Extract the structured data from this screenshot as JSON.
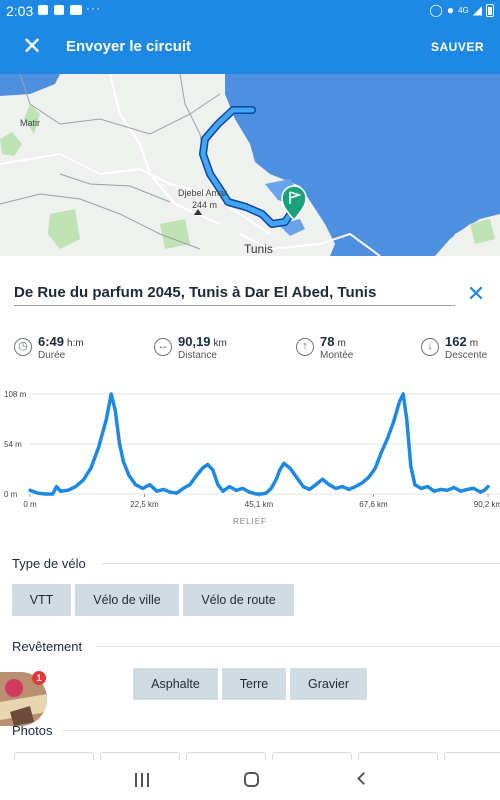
{
  "status_bar": {
    "time": "2:03",
    "dots": "···",
    "network": "4G"
  },
  "app_bar": {
    "title": "Envoyer le circuit",
    "save_label": "SAUVER"
  },
  "map": {
    "labels": {
      "matir": "Matir",
      "djebel": "Djebel Amar",
      "altitude": "244 m",
      "tunis": "Tunis"
    },
    "colors": {
      "sea": "#4f8fe0",
      "land": "#eef1ee",
      "route": "#1e88e5",
      "route_casing": "#0d47a1",
      "marker": "#1aa37a"
    }
  },
  "route": {
    "name": "De Rue du parfum 2045, Tunis à Dar El Abed, Tunis"
  },
  "stats": [
    {
      "icon": "clock-icon",
      "value": "6:49",
      "unit": "h:m",
      "label": "Durée"
    },
    {
      "icon": "distance-icon",
      "value": "90,19",
      "unit": "km",
      "label": "Distance"
    },
    {
      "icon": "arrow-up-icon",
      "value": "78",
      "unit": "m",
      "label": "Montée"
    },
    {
      "icon": "arrow-down-icon",
      "value": "162",
      "unit": "m",
      "label": "Descente"
    }
  ],
  "chart_data": {
    "type": "line",
    "title": "",
    "caption": "RELIEF",
    "xlabel": "",
    "ylabel": "",
    "x_ticks": [
      "0 m",
      "22,5 km",
      "45,1 km",
      "67,6 km",
      "90,2 km"
    ],
    "y_ticks": [
      "0 m",
      "54 m",
      "108 m"
    ],
    "xlim": [
      0,
      90.2
    ],
    "ylim": [
      0,
      108
    ],
    "grid": true,
    "color": "#1e88e5",
    "series": [
      {
        "x": [
          0,
          1.5,
          3,
          4.5,
          5.2,
          6,
          7.5,
          9,
          10.5,
          12,
          13.5,
          15,
          16,
          16.8,
          17.6,
          18.4,
          19.5,
          20.8,
          22.2,
          23.6,
          25,
          26.3,
          27.6,
          28.9,
          30.2,
          31.5,
          32.8,
          34,
          35,
          36,
          37,
          38,
          39.3,
          40.6,
          41.9,
          43.2,
          44.5,
          45.5,
          46.5,
          47.5,
          48.5,
          49.2,
          50,
          51.2,
          52.5,
          53.8,
          55,
          56.3,
          57.6,
          58.9,
          60.2,
          61.5,
          62.8,
          64.1,
          65.4,
          66.7,
          68,
          69.2,
          70.4,
          71.6,
          72.8,
          73.5,
          74.2,
          75,
          75.8,
          77,
          78.3,
          79.6,
          80.9,
          82.2,
          83.5,
          84.8,
          86.1,
          87.4,
          88.7,
          89.5,
          90.2
        ],
        "y": [
          4,
          1,
          0,
          0,
          8,
          3,
          4,
          8,
          15,
          28,
          50,
          80,
          108,
          90,
          55,
          35,
          20,
          10,
          6,
          10,
          3,
          5,
          2,
          1,
          6,
          10,
          20,
          28,
          32,
          26,
          10,
          3,
          8,
          4,
          6,
          2,
          0,
          0,
          1,
          6,
          16,
          26,
          33,
          28,
          18,
          8,
          5,
          10,
          16,
          10,
          6,
          8,
          5,
          8,
          12,
          18,
          28,
          45,
          60,
          78,
          100,
          108,
          80,
          30,
          10,
          6,
          8,
          3,
          5,
          4,
          7,
          3,
          5,
          6,
          2,
          4,
          8
        ]
      }
    ]
  },
  "bike_type": {
    "title": "Type de vélo",
    "options": [
      "VTT",
      "Vélo de ville",
      "Vélo de route"
    ]
  },
  "surface": {
    "title": "Revêtement",
    "options": [
      "Asphalte",
      "Terre",
      "Gravier"
    ]
  },
  "avatar": {
    "badge_count": "1"
  },
  "photos": {
    "title": "Photos"
  }
}
